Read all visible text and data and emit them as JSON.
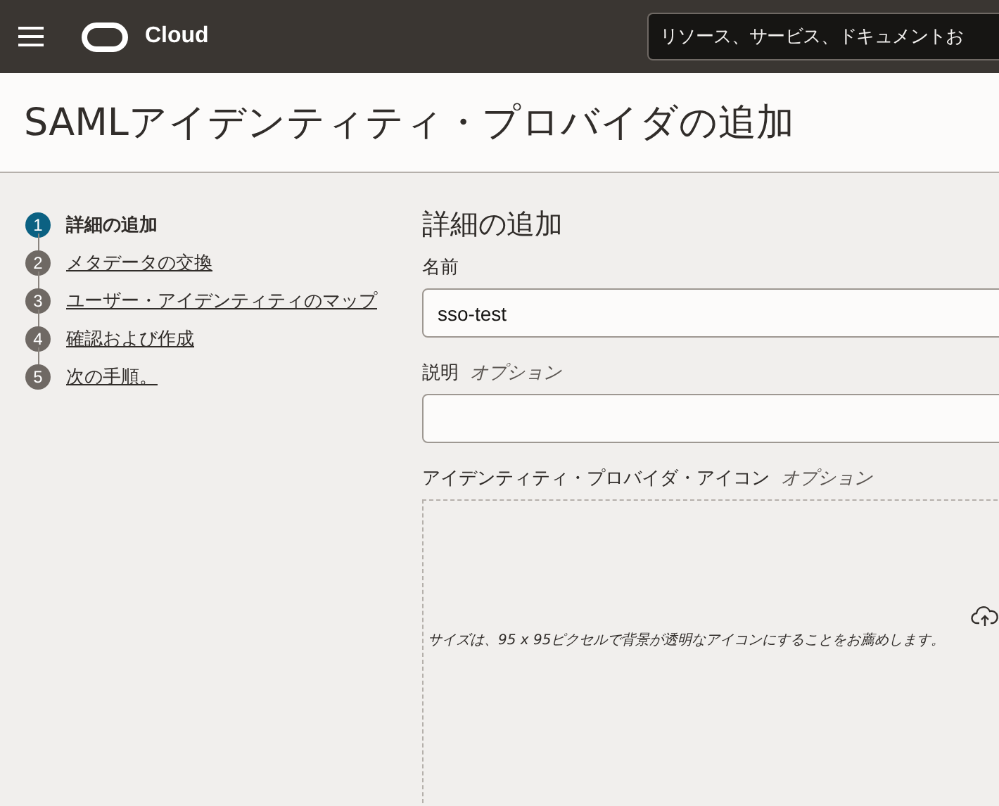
{
  "header": {
    "brand": "Cloud",
    "search": {
      "placeholder": "リソース、サービス、ドキュメントお"
    }
  },
  "page_title": "SAMLアイデンティティ・プロバイダの追加",
  "steps": [
    {
      "number": "1",
      "label": "詳細の追加",
      "selected": true
    },
    {
      "number": "2",
      "label": "メタデータの交換",
      "selected": false
    },
    {
      "number": "3",
      "label": "ユーザー・アイデンティティのマップ",
      "selected": false
    },
    {
      "number": "4",
      "label": "確認および作成",
      "selected": false
    },
    {
      "number": "5",
      "label": "次の手順。",
      "selected": false
    }
  ],
  "section_title": "詳細の追加",
  "fields": [
    {
      "label": "名前",
      "value": "sso-test"
    },
    {
      "label": "説明",
      "optional": "オプション"
    }
  ],
  "icon_upload": {
    "label": "アイデンティティ・プロバイダ・アイコン",
    "optional": "オプション",
    "hint": "サイズは、95 x 95ピクセルで背景が透明なアイコンにすることをお薦めします。"
  }
}
